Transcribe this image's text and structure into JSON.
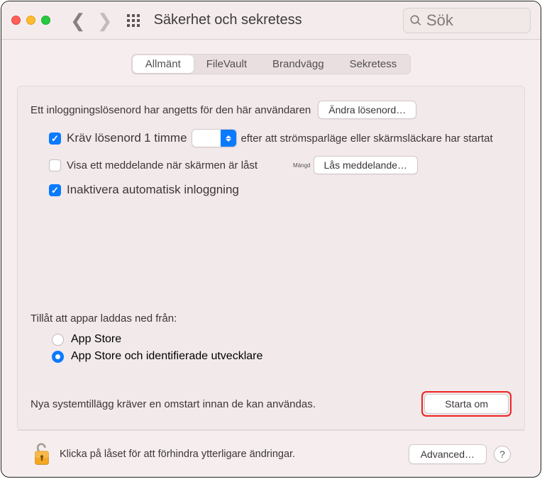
{
  "header": {
    "title": "Säkerhet och sekretess",
    "search_placeholder": "Sök"
  },
  "tabs": [
    "Allmänt",
    "FileVault",
    "Brandvägg",
    "Sekretess"
  ],
  "active_tab": 0,
  "password_set_label": "Ett inloggningslösenord har angetts för den här användaren",
  "change_password_btn": "Ändra lösenord…",
  "require_password": {
    "checked": true,
    "prefix": "Kräv lösenord",
    "interval": "1 timme",
    "dropdown_value": "",
    "suffix": "efter att strömsparläge eller skärmsläckare har startat"
  },
  "show_message": {
    "checked": false,
    "label": "Visa ett meddelande när skärmen är låst",
    "tiny": "Mängd",
    "btn": "Lås meddelande…"
  },
  "disable_autologin": {
    "checked": true,
    "label": "Inaktivera automatisk inloggning"
  },
  "allow_apps": {
    "title": "Tillåt att appar laddas ned från:",
    "options": [
      "App Store",
      "App Store och identifierade utvecklare"
    ],
    "selected": 1
  },
  "notice": "Nya systemtillägg kräver en omstart innan de kan användas.",
  "restart_btn": "Starta om",
  "footer": {
    "lock_text": "Klicka på låset för att förhindra ytterligare ändringar.",
    "advanced_btn": "Advanced…",
    "help": "?"
  }
}
